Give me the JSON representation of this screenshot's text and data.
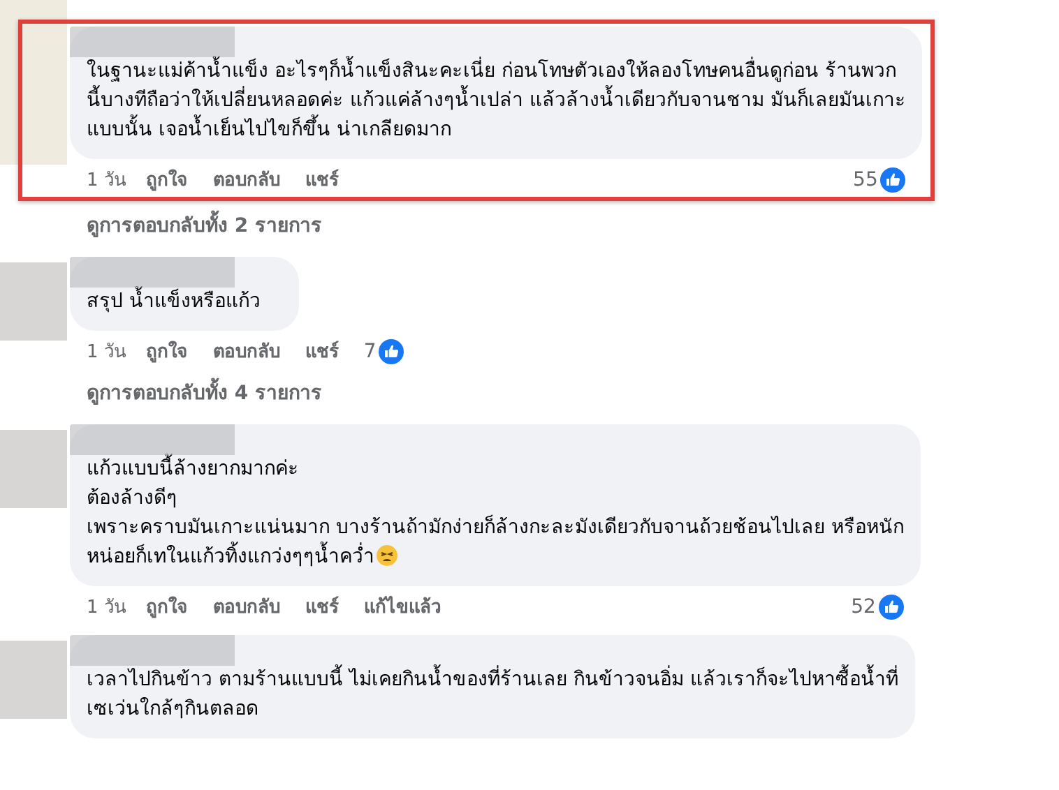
{
  "comments": [
    {
      "highlighted": true,
      "text": "ในฐานะแม่ค้าน้ำแข็ง อะไรๆก็น้ำแข็งสินะคะเนี่ย ก่อนโทษตัวเองให้ลองโทษคนอื่นดูก่อน ร้านพวก\nนี้บางทีถือว่าให้เปลี่ยนหลอดค่ะ แก้วแค่ล้างๆน้ำเปล่า แล้วล้างน้ำเดียวกับจานชาม มันก็เลยมันเกาะ\nแบบนั้น เจอน้ำเย็นไปไขก็ขึ้น น่าเกลียดมาก",
      "time": "1 วัน",
      "actions": [
        "ถูกใจ",
        "ตอบกลับ",
        "แชร์"
      ],
      "likes": "55",
      "replies_link": "ดูการตอบกลับทั้ง 2 รายการ"
    },
    {
      "highlighted": false,
      "text": "สรุป น้ำแข็งหรือแก้ว",
      "time": "1 วัน",
      "actions": [
        "ถูกใจ",
        "ตอบกลับ",
        "แชร์"
      ],
      "likes": "7",
      "replies_link": "ดูการตอบกลับทั้ง 4 รายการ"
    },
    {
      "highlighted": false,
      "text": "แก้วแบบนี้ล้างยากมากค่ะ\nต้องล้างดีๆ\nเพราะคราบมันเกาะแน่นมาก บางร้านถ้ามักง่ายก็ล้างกะละมังเดียวกับจานถ้วยช้อนไปเลย หรือหนัก\nหน่อยก็เทในแก้วทิ้งแกว่งๆๆน้ำคว่ำ",
      "emoji": true,
      "time": "1 วัน",
      "actions": [
        "ถูกใจ",
        "ตอบกลับ",
        "แชร์"
      ],
      "edited": "แก้ไขแล้ว",
      "likes": "52"
    },
    {
      "highlighted": false,
      "text": "เวลาไปกินข้าว ตามร้านแบบนี้ ไม่เคยกินน้ำของที่ร้านเลย กินข้าวจนอิ่ม แล้วเราก็จะไปหาซื้อน้ำที่\nเซเว่นใกล้ๆกินตลอด"
    }
  ]
}
